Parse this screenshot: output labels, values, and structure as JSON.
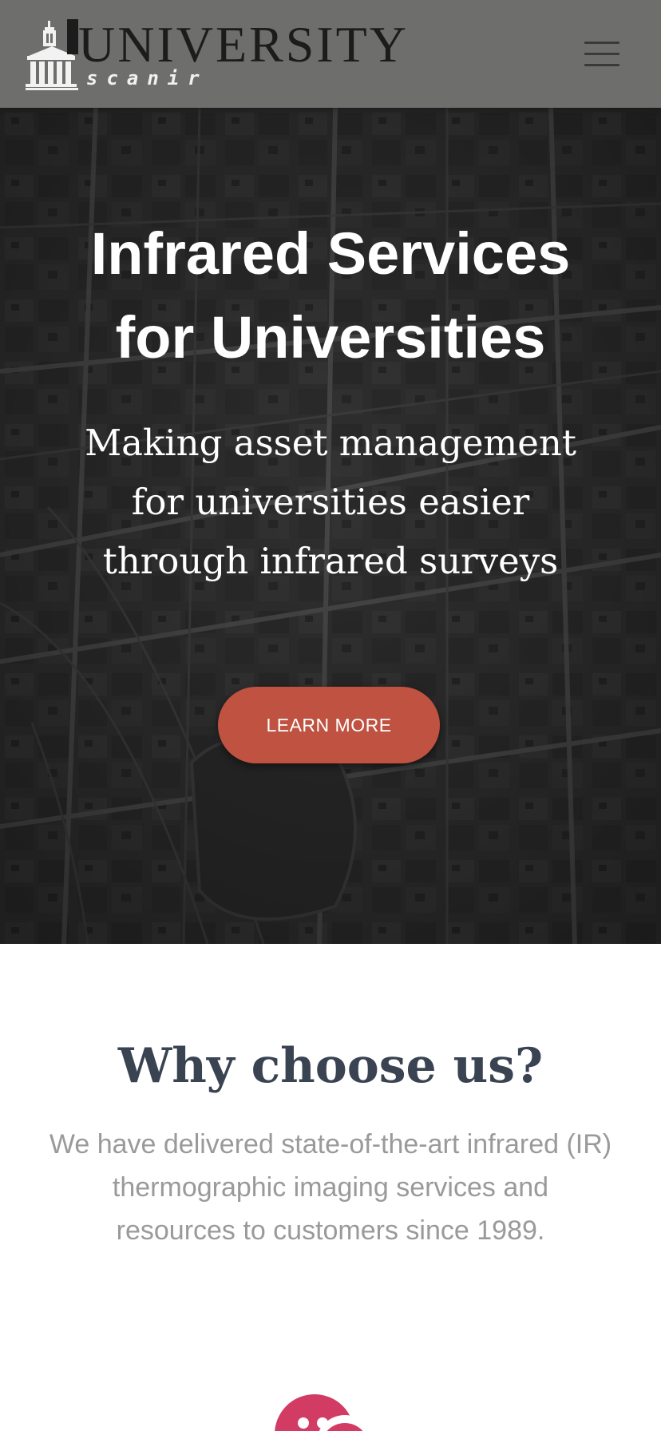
{
  "header": {
    "logo_word": "UNIVERSITY",
    "logo_sub": "scanir",
    "menu_icon": "hamburger-menu-icon",
    "background_color": "#6e6e6d"
  },
  "hero": {
    "title_line1": "Infrared Services",
    "title_line2": "for Universities",
    "subtitle_line1": "Making asset management",
    "subtitle_line2": "for universities easier",
    "subtitle_line3": "through infrared surveys",
    "cta_label": "LEARN MORE",
    "cta_color": "#bf5240"
  },
  "why": {
    "title": "Why choose us?",
    "text_line1": "We have delivered state-of-the-art infrared (IR)",
    "text_line2": "thermographic imaging services and",
    "text_line3": "resources to customers since 1989.",
    "icon": "chat-bubbles-icon",
    "icon_color": "#d23c64",
    "title_color": "#3a4352"
  }
}
